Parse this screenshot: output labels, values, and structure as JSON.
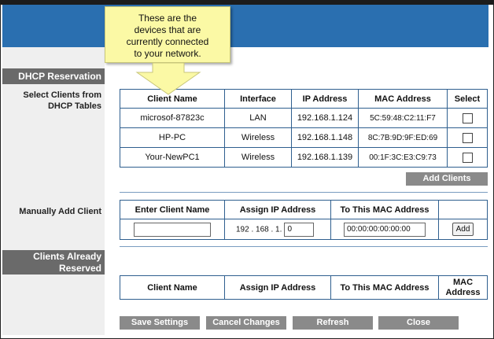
{
  "callout": {
    "lines": [
      "These are the",
      "devices that are",
      "currently connected",
      "to your network."
    ]
  },
  "sidebar": {
    "dhcp_reservation": "DHCP Reservation",
    "select_clients": [
      "Select Clients from",
      "DHCP Tables"
    ],
    "manually_add": "Manually Add Client",
    "clients_reserved": [
      "Clients Already",
      "Reserved"
    ]
  },
  "dhcp_table": {
    "headers": [
      "Client Name",
      "Interface",
      "IP Address",
      "MAC Address",
      "Select"
    ],
    "rows": [
      {
        "client_name": "microsof-87823c",
        "interface": "LAN",
        "ip": "192.168.1.124",
        "mac": "5C:59:48:C2:11:F7"
      },
      {
        "client_name": "HP-PC",
        "interface": "Wireless",
        "ip": "192.168.1.148",
        "mac": "8C:7B:9D:9F:ED:69"
      },
      {
        "client_name": "Your-NewPC1",
        "interface": "Wireless",
        "ip": "192.168.1.139",
        "mac": "00:1F:3C:E3:C9:73"
      }
    ]
  },
  "add_clients_label": "Add Clients",
  "manual_table": {
    "headers": [
      "Enter Client Name",
      "Assign IP Address",
      "To This MAC Address"
    ],
    "ip_prefix": "192 . 168 . 1.",
    "ip_last_value": "0",
    "client_name_value": "",
    "mac_value": "00:00:00:00:00:00",
    "add_label": "Add"
  },
  "reserved_table": {
    "headers": [
      "Client Name",
      "Assign IP Address",
      "To This MAC Address"
    ],
    "mac_header_lines": [
      "MAC",
      "Address"
    ]
  },
  "buttons": {
    "save": "Save Settings",
    "cancel": "Cancel Changes",
    "refresh": "Refresh",
    "close": "Close"
  },
  "colors": {
    "banner": "#2a6fb0",
    "sidebar_header": "#6a6a6a",
    "button": "#8a8a8a",
    "callout": "#fbf9a5",
    "table_border": "#2f5f8f"
  }
}
